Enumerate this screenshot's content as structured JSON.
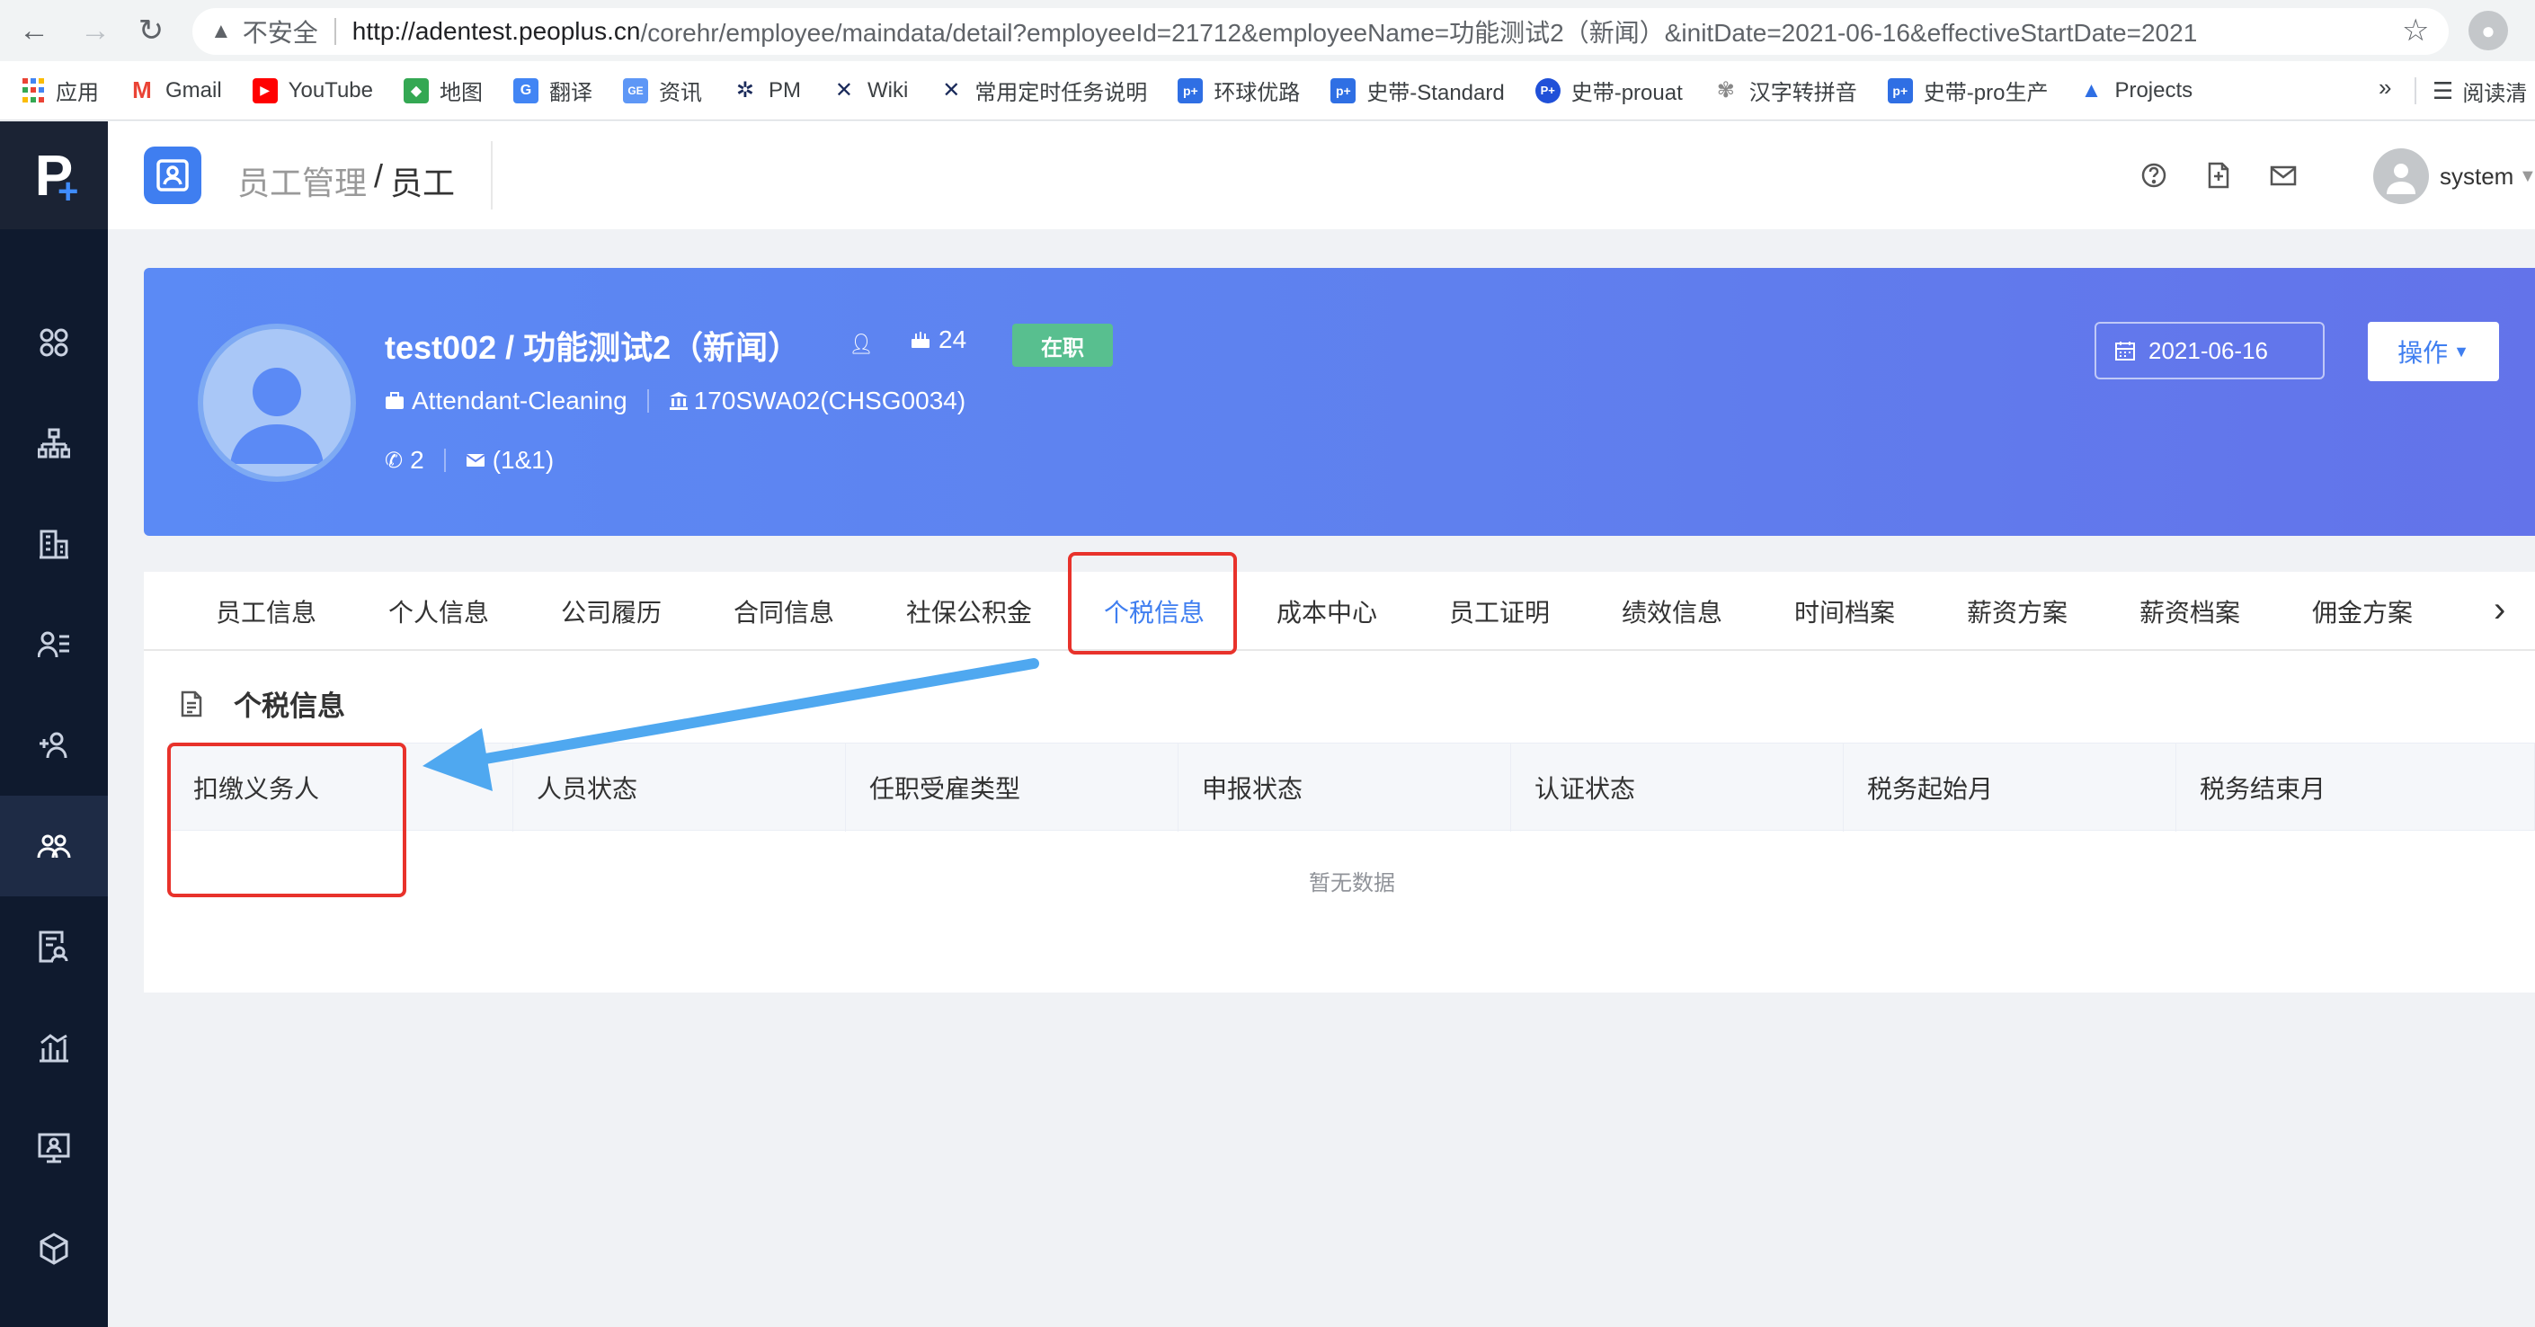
{
  "browser": {
    "insecure_label": "不安全",
    "url_host": "http://adentest.peoplus.cn",
    "url_path": "/corehr/employee/maindata/detail?employeeId=21712&employeeName=功能测试2（新闻）&initDate=2021-06-16&effectiveStartDate=2021",
    "bookmarks": [
      "应用",
      "Gmail",
      "YouTube",
      "地图",
      "翻译",
      "资讯",
      "PM",
      "Wiki",
      "常用定时任务说明",
      "环球优路",
      "史带-Standard",
      "史带-prouat",
      "汉字转拼音",
      "史带-pro生产",
      "Projects"
    ],
    "more": "»",
    "reading_list": "阅读清"
  },
  "header": {
    "breadcrumb_parent": "员工管理",
    "breadcrumb_sep": "/",
    "breadcrumb_current": "员工",
    "user_name": "system"
  },
  "employee": {
    "name": "test002 / 功能测试2（新闻）",
    "age": "24",
    "status": "在职",
    "position": "Attendant-Cleaning",
    "org": "170SWA02(CHSG0034)",
    "phone_count": "2",
    "email": "(1&1)",
    "date": "2021-06-16",
    "action_label": "操作"
  },
  "tabs": [
    "员工信息",
    "个人信息",
    "公司履历",
    "合同信息",
    "社保公积金",
    "个税信息",
    "成本中心",
    "员工证明",
    "绩效信息",
    "时间档案",
    "薪资方案",
    "薪资档案",
    "佣金方案"
  ],
  "active_tab": "个税信息",
  "section": {
    "title": "个税信息",
    "columns": [
      "扣缴义务人",
      "人员状态",
      "任职受雇类型",
      "申报状态",
      "认证状态",
      "税务起始月",
      "税务结束月"
    ],
    "empty_text": "暂无数据"
  },
  "colors": {
    "accent": "#3f7ef0",
    "sidebar": "#0f1a2e",
    "status_green": "#58bf8f",
    "annotation_red": "#e8322b",
    "annotation_arrow": "#4fa8f0"
  }
}
